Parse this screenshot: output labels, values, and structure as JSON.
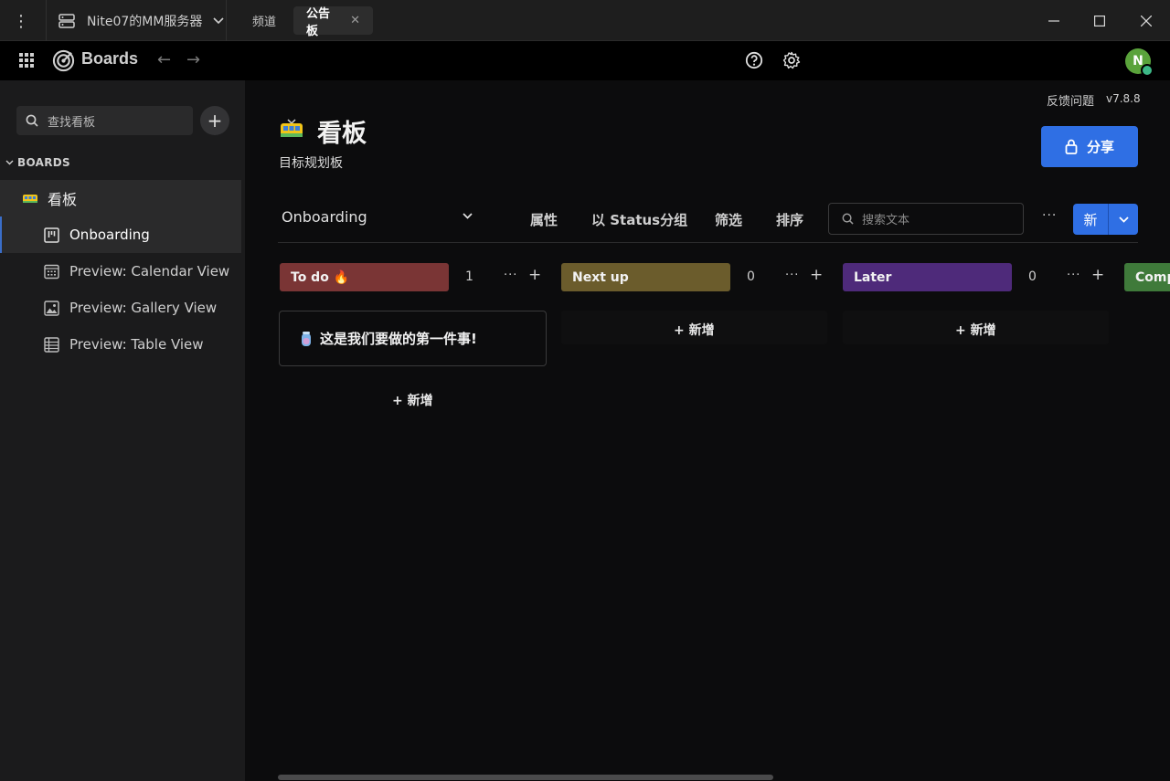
{
  "titlebar": {
    "server_name": "Nite07的MM服务器",
    "tabs": [
      {
        "label": "频道"
      },
      {
        "label": "公告板"
      }
    ]
  },
  "appbar": {
    "title": "Boards"
  },
  "sidebar": {
    "search_placeholder": "查找看板",
    "boards_heading": "BOARDS",
    "board_name": "看板",
    "views": [
      {
        "label": "Onboarding",
        "icon": "board-view-icon"
      },
      {
        "label": "Preview: Calendar View",
        "icon": "calendar-icon"
      },
      {
        "label": "Preview: Gallery View",
        "icon": "gallery-icon"
      },
      {
        "label": "Preview: Table View",
        "icon": "table-icon"
      }
    ]
  },
  "main": {
    "feedback": "反馈问题",
    "version": "v7.8.8",
    "board_title": "看板",
    "board_description": "目标规划板",
    "share_label": "分享",
    "viewbar": {
      "current_view": "Onboarding",
      "properties": "属性",
      "group_by": "以 Status分组",
      "filter": "筛选",
      "sort": "排序",
      "search_placeholder": "搜索文本",
      "new_label": "新"
    },
    "columns": [
      {
        "label": "To do 🔥",
        "count": "1",
        "color": "#7a3535"
      },
      {
        "label": "Next up",
        "count": "0",
        "color": "#6b5c2c"
      },
      {
        "label": "Later",
        "count": "0",
        "color": "#4e2a7a"
      },
      {
        "label": "Comp",
        "color": "#3f7a3a"
      }
    ],
    "card_title": "这是我们要做的第一件事!",
    "add_label": "+ 新增"
  },
  "colors": {
    "accent": "#2f6fe4",
    "sidebar_bg": "#1b1b1c",
    "main_bg": "#0c0c0d"
  }
}
